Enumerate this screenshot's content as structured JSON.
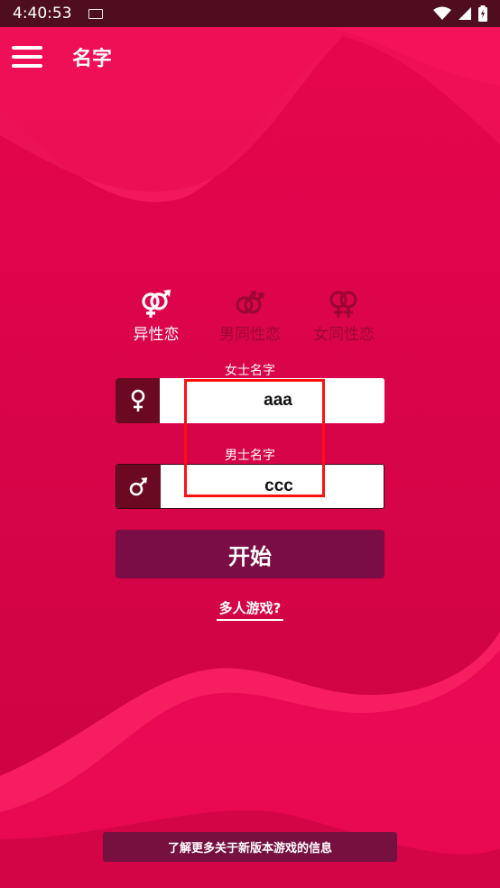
{
  "status_bar": {
    "time": "4:40:53"
  },
  "app_bar": {
    "title": "名字"
  },
  "modes": [
    {
      "label": "异性恋",
      "icon": "hetero-symbol-icon",
      "active": true
    },
    {
      "label": "男同性恋",
      "icon": "male-male-symbol-icon",
      "active": false
    },
    {
      "label": "女同性恋",
      "icon": "female-female-symbol-icon",
      "active": false
    }
  ],
  "female_field": {
    "label": "女士名字",
    "value": "aaa"
  },
  "male_field": {
    "label": "男士名字",
    "value": "ccc"
  },
  "start_button": {
    "label": "开始"
  },
  "multiplayer_link": {
    "label": "多人游戏?"
  },
  "info_banner": {
    "label": "了解更多关于新版本游戏的信息"
  },
  "colors": {
    "background": "#e8064e",
    "status_bar": "#4e0e1f",
    "field_prefix": "#6b0822",
    "start_button": "#7a0d45",
    "highlight": "#ff1010",
    "inactive_mode": "#9c0632"
  }
}
